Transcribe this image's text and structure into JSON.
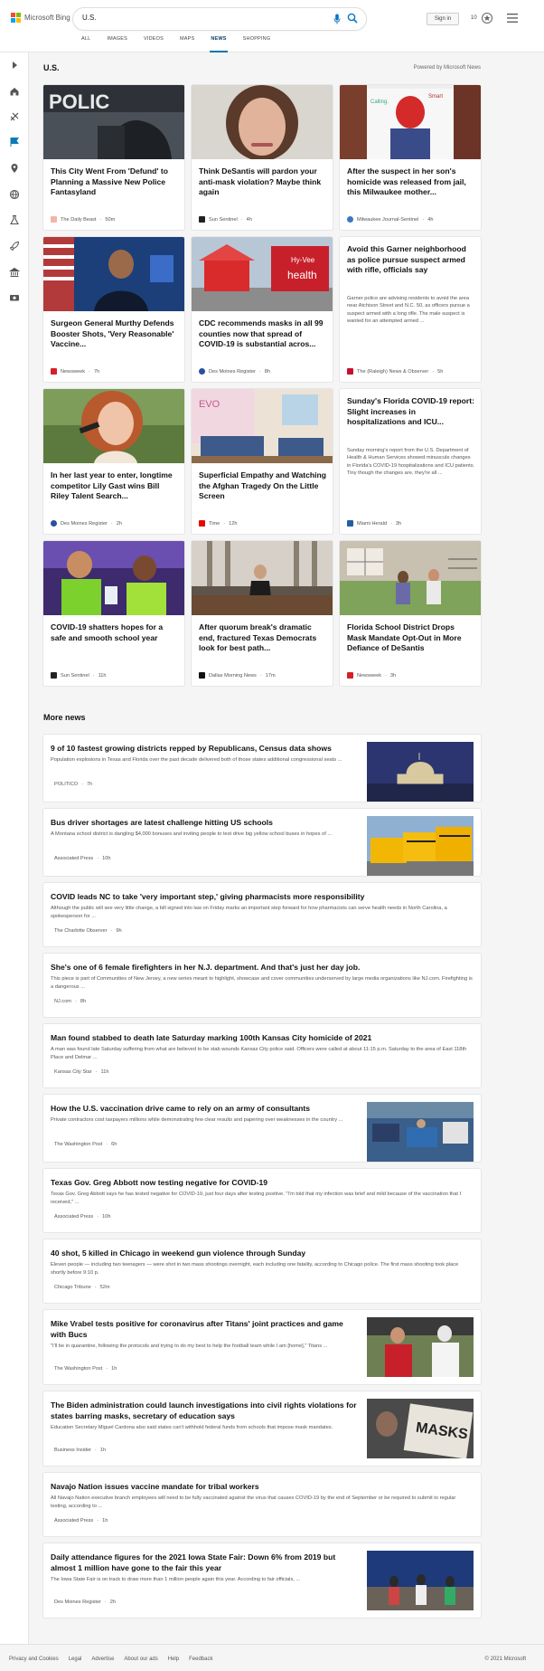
{
  "brand": {
    "name": "Microsoft Bing",
    "tile_colors": [
      "#f25022",
      "#7fba00",
      "#00a4ef",
      "#ffb900"
    ]
  },
  "search": {
    "query": "U.S."
  },
  "header": {
    "signin_label": "Sign in",
    "rewards_count": "10"
  },
  "tabs": [
    {
      "label": "ALL"
    },
    {
      "label": "IMAGES"
    },
    {
      "label": "VIDEOS"
    },
    {
      "label": "MAPS"
    },
    {
      "label": "NEWS"
    },
    {
      "label": "SHOPPING"
    }
  ],
  "active_tab": "NEWS",
  "section": {
    "title": "U.S.",
    "powered_by": "Powered by Microsoft News"
  },
  "cards": [
    {
      "title": "This City Went From 'Defund' to Planning a Massive New Police Fantasyland",
      "source": "The Daily Beast",
      "time": "50m",
      "src_color": "#f6b3a8"
    },
    {
      "title": "Think DeSantis will pardon your anti-mask violation? Maybe think again",
      "source": "Sun Sentinel",
      "time": "4h",
      "src_color": "#222222"
    },
    {
      "title": "After the suspect in her son's homicide was released from jail, this Milwaukee mother...",
      "source": "Milwaukee Journal-Sentinel",
      "time": "4h",
      "src_color": "#3a78c3"
    },
    {
      "title": "Surgeon General Murthy Defends Booster Shots, 'Very Reasonable' Vaccine...",
      "source": "Newsweek",
      "time": "7h",
      "src_color": "#d61f26"
    },
    {
      "title": "CDC recommends masks in all 99 counties now that spread of COVID-19 is substantial acros...",
      "source": "Des Moines Register",
      "time": "8h",
      "src_color": "#2a4ea0"
    },
    {
      "title": "Avoid this Garner neighborhood as police pursue suspect armed with rifle, officials say",
      "snippet": "Garner police are advising residents to avoid the area near Atchison Street and N.C. 50, as officers pursue a suspect armed with a long rifle. The male suspect is wanted for an attempted armed ...",
      "source": "The (Raleigh) News & Observer",
      "time": "5h",
      "src_color": "#c8102e"
    },
    {
      "title": "In her last year to enter, longtime competitor Lily Gast wins Bill Riley Talent Search...",
      "source": "Des Moines Register",
      "time": "2h",
      "src_color": "#2a4ea0"
    },
    {
      "title": "Superficial Empathy and Watching the Afghan Tragedy On the Little Screen",
      "source": "Time",
      "time": "12h",
      "src_color": "#e90606"
    },
    {
      "title": "Sunday's Florida COVID-19 report: Slight increases in hospitalizations and ICU...",
      "snippet": "Sunday morning's report from the U.S. Department of Health & Human Services showed minuscule changes in Florida's COVID-19 hospitalizations and ICU patients. Tiny though the changes are, they're all ...",
      "source": "Miami Herald",
      "time": "3h",
      "src_color": "#1f5fa8"
    },
    {
      "title": "COVID-19 shatters hopes for a safe and smooth school year",
      "source": "Sun Sentinel",
      "time": "11h",
      "src_color": "#222222"
    },
    {
      "title": "After quorum break's dramatic end, fractured Texas Democrats look for best path...",
      "source": "Dallas Morning News",
      "time": "17m",
      "src_color": "#111111"
    },
    {
      "title": "Florida School District Drops Mask Mandate Opt-Out in More Defiance of DeSantis",
      "source": "Newsweek",
      "time": "3h",
      "src_color": "#d61f26"
    }
  ],
  "more_news": {
    "title": "More news",
    "items": [
      {
        "title": "9 of 10 fastest growing districts repped by Republicans, Census data shows",
        "snippet": "Population explosions in Texas and Florida over the past decade delivered both of those states additional congressional seats ...",
        "source": "POLITICO",
        "time": "7h",
        "src_color": "#d1202f"
      },
      {
        "title": "Bus driver shortages are latest challenge hitting US schools",
        "snippet": "A Montana school district is dangling $4,000 bonuses and inviting people to test drive big yellow school buses in hopes of ...",
        "source": "Associated Press",
        "time": "10h",
        "src_color": "#d00000"
      },
      {
        "title": "COVID leads NC to take 'very important step,' giving pharmacists more responsibility",
        "snippet": "Although the public will see very little change, a bill signed into law on Friday marks an important step forward for how pharmacists can serve health needs in North Carolina, a spokesperson for ...",
        "source": "The Charlotte Observer",
        "time": "9h",
        "src_color": "#1a6fb5"
      },
      {
        "title": "She's one of 6 female firefighters in her N.J. department. And that's just her day job.",
        "snippet": "This piece is part of Communities of New Jersey, a new series meant to highlight, showcase and cover communities underserved by large media organizations like NJ.com. Firefighting is a dangerous ...",
        "source": "NJ.com",
        "time": "8h",
        "src_color": "#555555"
      },
      {
        "title": "Man found stabbed to death late Saturday marking 100th Kansas City homicide of 2021",
        "snippet": "A man was found late Saturday suffering from what are believed to be stab wounds Kansas City police said. Officers were called at about 11:15 p.m. Saturday to the area of East 118th Place and Delmar ...",
        "source": "Kansas City Star",
        "time": "11h",
        "src_color": "#1f5fa8"
      },
      {
        "title": "How the U.S. vaccination drive came to rely on an army of consultants",
        "snippet": "Private contractors cost taxpayers millions while demonstrating few clear results and papering over weaknesses in the country ...",
        "source": "The Washington Post",
        "time": "6h",
        "src_color": "#222222"
      },
      {
        "title": "Texas Gov. Greg Abbott now testing negative for COVID-19",
        "snippet": "Texas Gov. Greg Abbott says he has tested negative for COVID-19, just four days after testing positive. \"I'm told that my infection was brief and mild because of the vaccination that I received,\" ...",
        "source": "Associated Press",
        "time": "10h",
        "src_color": "#d00000"
      },
      {
        "title": "40 shot, 5 killed in Chicago in weekend gun violence through Sunday",
        "snippet": "Eleven people — including two teenagers — were shot in two mass shootings overnight, each including one fatality, according to Chicago police. The first mass shooting took place shortly before 9:10 p.",
        "source": "Chicago Tribune",
        "time": "52m",
        "src_color": "#1f5fa8"
      },
      {
        "title": "Mike Vrabel tests positive for coronavirus after Titans' joint practices and game with Bucs",
        "snippet": "\"I'll be in quarantine, following the protocols and trying to do my best to help the football team while I am [home],\" Titans ...",
        "source": "The Washington Post",
        "time": "1h",
        "src_color": "#222222"
      },
      {
        "title": "The Biden administration could launch investigations into civil rights violations for states barring masks, secretary of education says",
        "snippet": "Education Secretary Miguel Cardona also said states can't withhold federal funds from schools that impose mask mandates.",
        "source": "Business Insider",
        "time": "1h",
        "src_color": "#1e5ac8"
      },
      {
        "title": "Navajo Nation issues vaccine mandate for tribal workers",
        "snippet": "All Navajo Nation executive branch employees will need to be fully vaccinated against the virus that causes COVID-19 by the end of September or be required to submit to regular testing, according to ...",
        "source": "Associated Press",
        "time": "1h",
        "src_color": "#d00000"
      },
      {
        "title": "Daily attendance figures for the 2021 Iowa State Fair: Down 6% from 2019 but almost 1 million have gone to the fair this year",
        "snippet": "The Iowa State Fair is on track to draw more than 1 million people again this year. According to fair officials, ...",
        "source": "Des Moines Register",
        "time": "2h",
        "src_color": "#2a4ea0"
      }
    ]
  },
  "footer": {
    "links": [
      "Privacy and Cookies",
      "Legal",
      "Advertise",
      "About our ads",
      "Help",
      "Feedback"
    ],
    "copyright": "© 2021 Microsoft"
  }
}
